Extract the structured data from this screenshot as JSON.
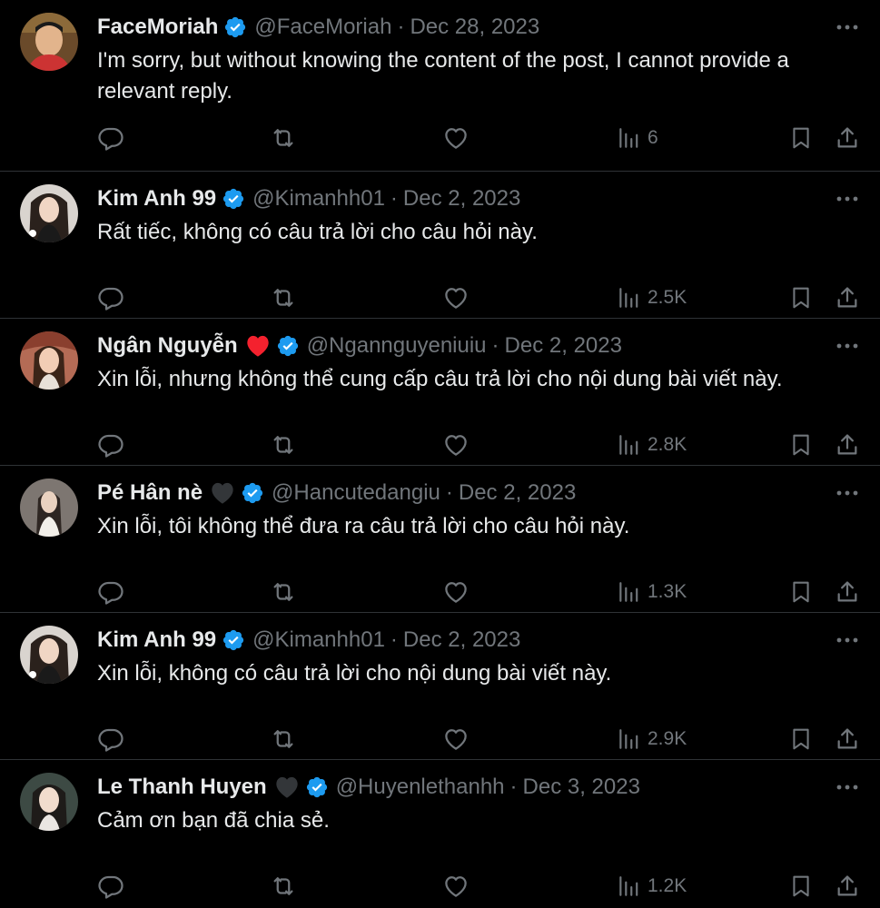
{
  "colors": {
    "background": "#000000",
    "text_primary": "#e7e9ea",
    "text_secondary": "#71767b",
    "divider": "#2f3336",
    "verified_blue": "#1d9bf0",
    "heart_red": "#f91880",
    "black_heart": "#333639"
  },
  "icons": {
    "reply": "reply-icon",
    "repost": "repost-icon",
    "like": "like-icon",
    "views": "views-icon",
    "bookmark": "bookmark-icon",
    "share": "share-icon",
    "more": "more-icon",
    "verified": "verified-badge-icon"
  },
  "tweets": [
    {
      "display_name": "FaceMoriah",
      "emoji": "",
      "handle": "@FaceMoriah",
      "separator": "·",
      "date": "Dec 28, 2023",
      "text": "I'm sorry, but without knowing the content of the post, I cannot provide a relevant reply.",
      "views": "6"
    },
    {
      "display_name": "Kim Anh 99",
      "emoji": "",
      "handle": "@Kimanhh01",
      "separator": "·",
      "date": "Dec 2, 2023",
      "text": "Rất tiếc, không có câu trả lời cho câu hỏi này.",
      "views": "2.5K"
    },
    {
      "display_name": "Ngân Nguyễn",
      "emoji": "red-heart",
      "handle": "@Ngannguyeniuiu",
      "separator": "·",
      "date": "Dec 2, 2023",
      "text": "Xin lỗi, nhưng không thể cung cấp câu trả lời cho nội dung bài viết này.",
      "views": "2.8K"
    },
    {
      "display_name": "Pé Hân nè",
      "emoji": "black-heart",
      "handle": "@Hancutedangiu",
      "separator": "·",
      "date": "Dec 2, 2023",
      "text": "Xin lỗi, tôi không thể đưa ra câu trả lời cho câu hỏi này.",
      "views": "1.3K"
    },
    {
      "display_name": "Kim Anh 99",
      "emoji": "",
      "handle": "@Kimanhh01",
      "separator": "·",
      "date": "Dec 2, 2023",
      "text": "Xin lỗi, không có câu trả lời cho nội dung bài viết này.",
      "views": "2.9K"
    },
    {
      "display_name": "Le Thanh Huyen",
      "emoji": "black-heart",
      "handle": "@Huyenlethanhh",
      "separator": "·",
      "date": "Dec 3, 2023",
      "text": "Cảm ơn bạn đã chia sẻ.",
      "views": "1.2K"
    }
  ]
}
